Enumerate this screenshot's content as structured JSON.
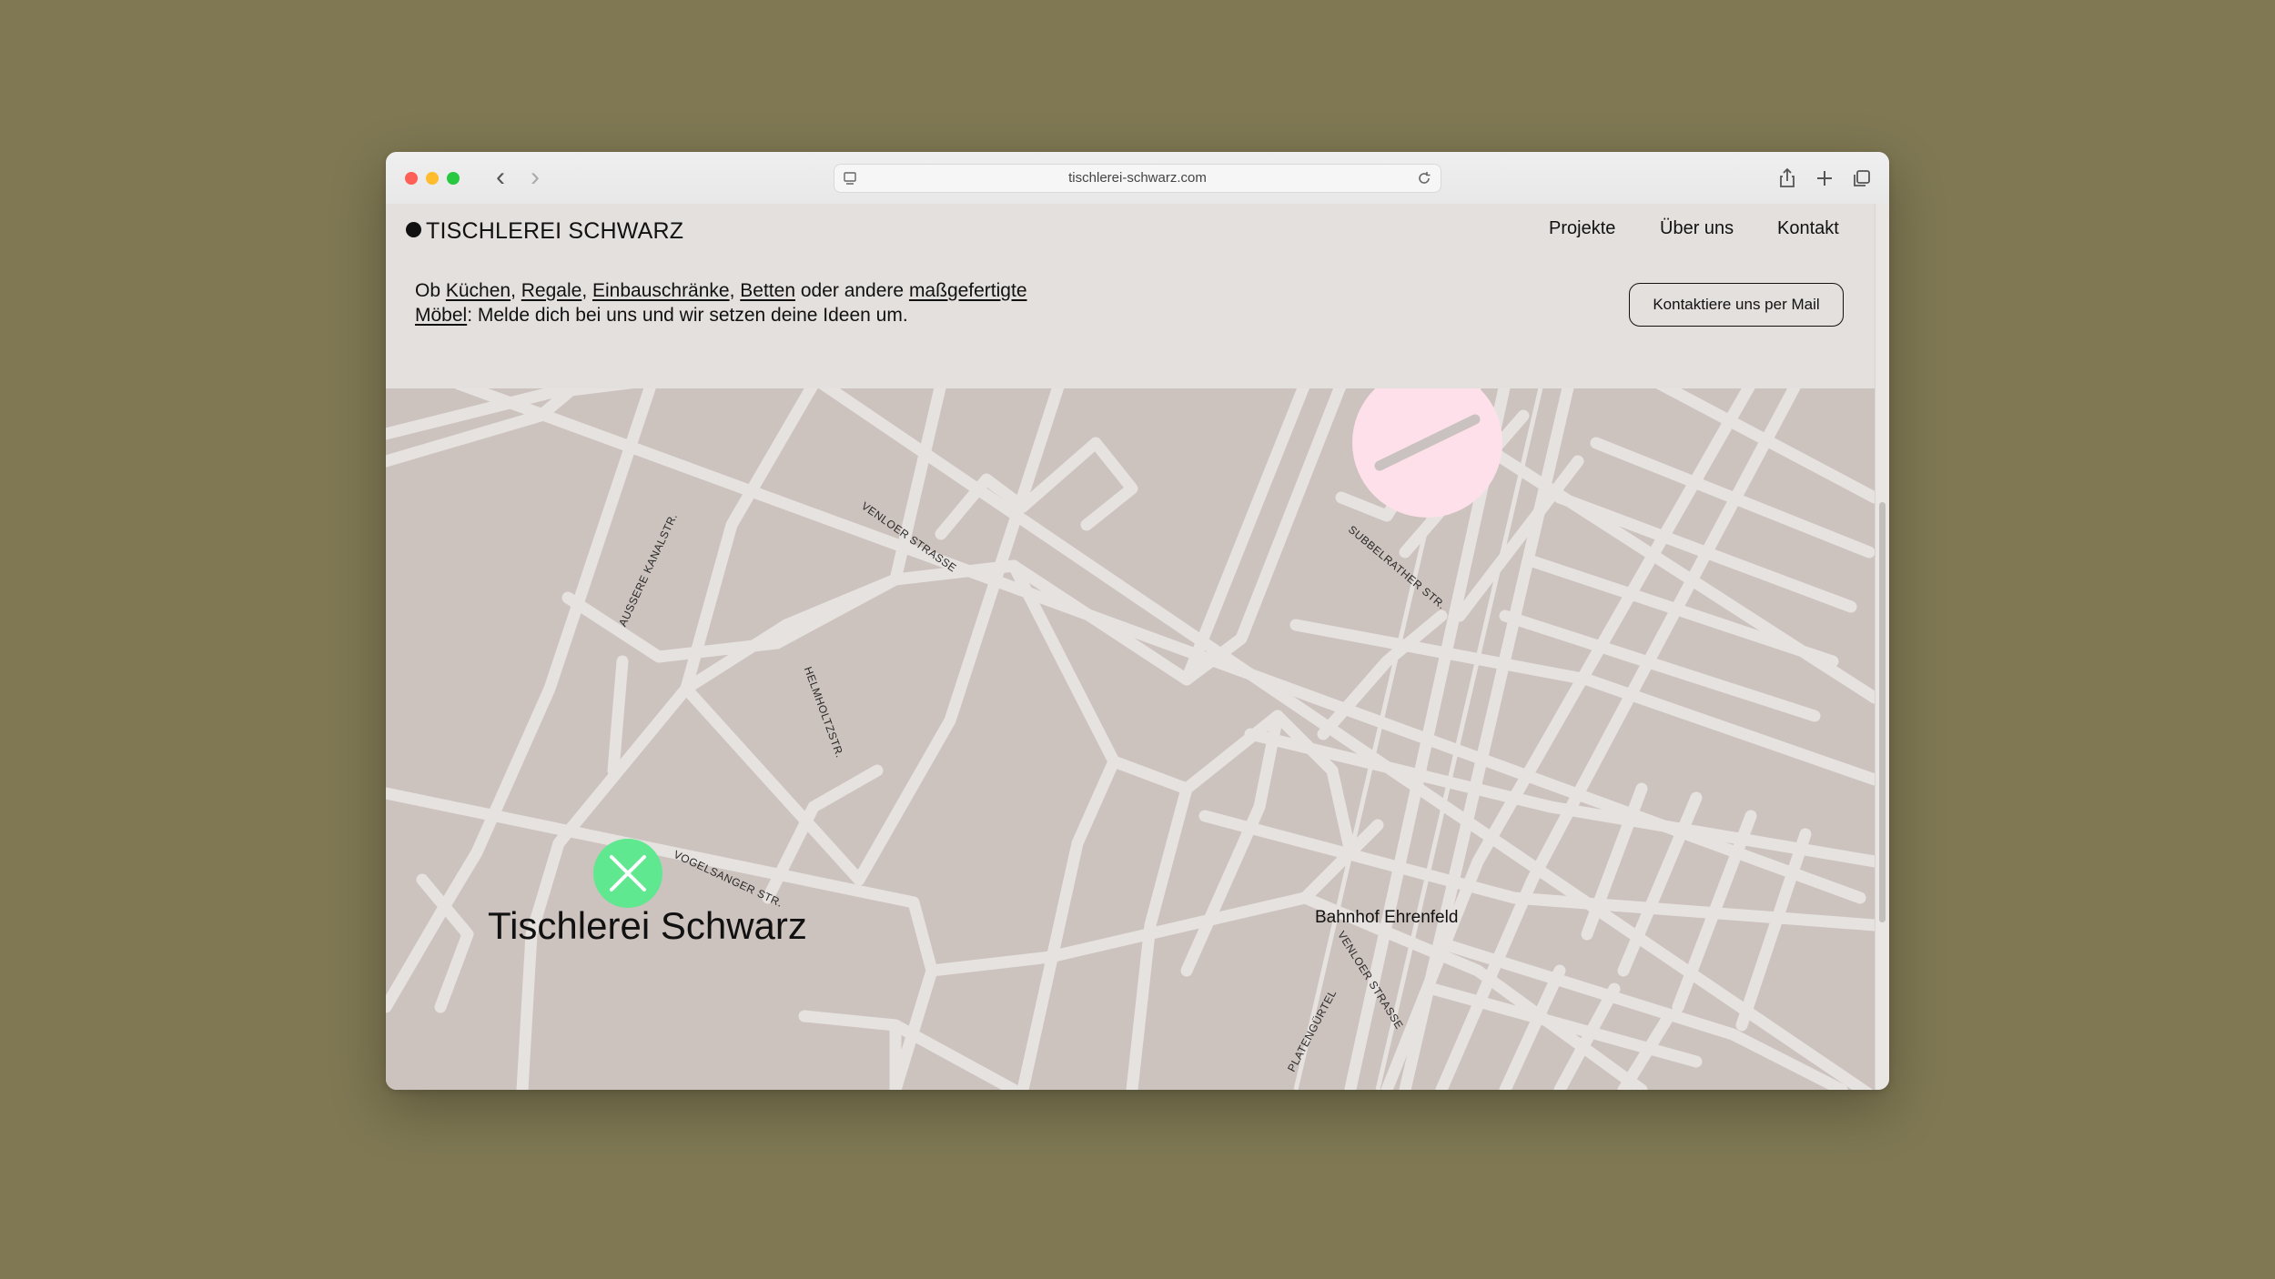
{
  "browser": {
    "url": "tischlerei-schwarz.com",
    "icons": [
      "close-dot",
      "minimize-dot",
      "zoom-dot",
      "back-arrow-icon",
      "forward-arrow-icon",
      "reader-icon",
      "reload-icon",
      "share-icon",
      "new-tab-icon",
      "tabs-overview-icon"
    ]
  },
  "site": {
    "logo": "TISCHLEREI SCHWARZ",
    "nav": [
      "Projekte",
      "Über uns",
      "Kontakt"
    ],
    "intro": {
      "prefix": "Ob ",
      "links": [
        "Küchen",
        "Regale",
        "Einbauschränke",
        "Betten",
        "maßgefertigte Möbel"
      ],
      "sep1": ", ",
      "sep2": ", ",
      "sep3": ", ",
      "mid": " oder andere ",
      "suffix": ": Melde dich bei uns und wir setzen deine Ideen um."
    },
    "cta": "Kontaktiere uns per Mail"
  },
  "map": {
    "title": "Tischlerei Schwarz",
    "place": "Bahnhof Ehrenfeld",
    "streets": [
      "AUSSERE KANALSTR.",
      "VENLOER STRASSE",
      "SUBBELRATHER STR.",
      "HELMHOLTZSTR.",
      "VOGELSANGER STR.",
      "VENLOER STRASSE",
      "PLATENGÜRTEL"
    ],
    "colors": {
      "background": "#ccc2be",
      "streets": "#e6e2e0",
      "marker_green": "#5fe890",
      "marker_pink": "#fde0ea"
    }
  }
}
